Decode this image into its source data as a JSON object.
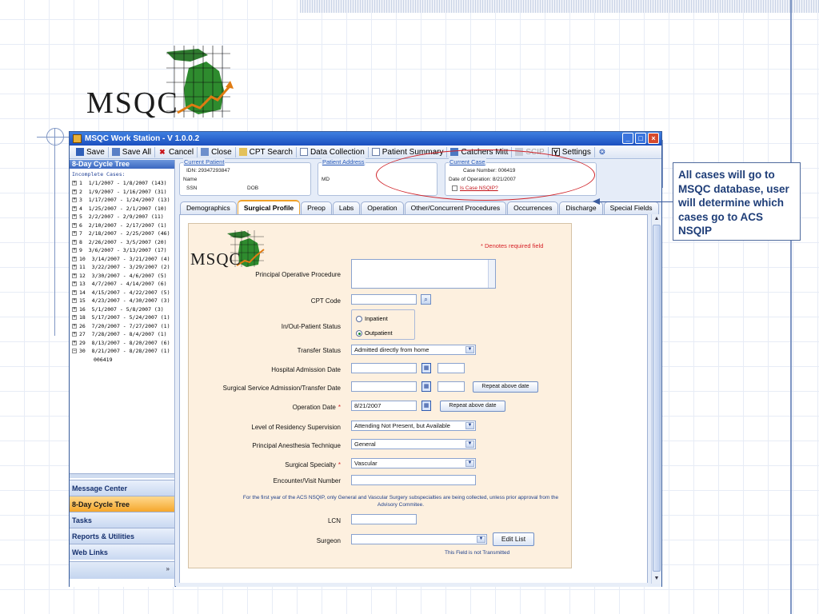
{
  "logo": {
    "text": "MSQC"
  },
  "window": {
    "title": "MSQC Work Station - V 1.0.0.2",
    "controls": [
      "_",
      "□",
      "×"
    ]
  },
  "toolbar": {
    "items": [
      {
        "label": "Save",
        "icon": "save-icon",
        "enabled": true
      },
      {
        "label": "Save All",
        "icon": "save-all-icon",
        "enabled": true
      },
      {
        "label": "Cancel",
        "icon": "cancel-icon",
        "enabled": true
      },
      {
        "label": "Close",
        "icon": "close-doc-icon",
        "enabled": true
      },
      {
        "label": "CPT Search",
        "icon": "cpt-search-icon",
        "enabled": true
      },
      {
        "label": "Data Collection",
        "icon": "document-icon",
        "enabled": true
      },
      {
        "label": "Patient Summary",
        "icon": "document-icon",
        "enabled": true
      },
      {
        "label": "Catchers Mitt",
        "icon": "chart-icon",
        "enabled": true
      },
      {
        "label": "SCIP",
        "icon": "scip-icon",
        "enabled": false
      },
      {
        "label": "Settings",
        "icon": "settings-icon",
        "enabled": true
      }
    ]
  },
  "sidebar": {
    "header": "8-Day Cycle Tree",
    "subheader": "Incomplete Cases:",
    "tree": [
      {
        "toggle": "+",
        "label": "1  1/1/2007 - 1/8/2007 (143)"
      },
      {
        "toggle": "+",
        "label": "2  1/9/2007 - 1/16/2007 (31)"
      },
      {
        "toggle": "+",
        "label": "3  1/17/2007 - 1/24/2007 (13)"
      },
      {
        "toggle": "+",
        "label": "4  1/25/2007 - 2/1/2007 (10)"
      },
      {
        "toggle": "+",
        "label": "5  2/2/2007 - 2/9/2007 (11)"
      },
      {
        "toggle": "+",
        "label": "6  2/10/2007 - 2/17/2007 (1)"
      },
      {
        "toggle": "+",
        "label": "7  2/18/2007 - 2/25/2007 (46)"
      },
      {
        "toggle": "+",
        "label": "8  2/26/2007 - 3/5/2007 (20)"
      },
      {
        "toggle": "+",
        "label": "9  3/6/2007 - 3/13/2007 (17)"
      },
      {
        "toggle": "+",
        "label": "10  3/14/2007 - 3/21/2007 (4)"
      },
      {
        "toggle": "+",
        "label": "11  3/22/2007 - 3/29/2007 (2)"
      },
      {
        "toggle": "+",
        "label": "12  3/30/2007 - 4/6/2007 (5)"
      },
      {
        "toggle": "+",
        "label": "13  4/7/2007 - 4/14/2007 (6)"
      },
      {
        "toggle": "+",
        "label": "14  4/15/2007 - 4/22/2007 (5)"
      },
      {
        "toggle": "+",
        "label": "15  4/23/2007 - 4/30/2007 (3)"
      },
      {
        "toggle": "+",
        "label": "16  5/1/2007 - 5/8/2007 (3)"
      },
      {
        "toggle": "+",
        "label": "18  5/17/2007 - 5/24/2007 (1)"
      },
      {
        "toggle": "+",
        "label": "26  7/20/2007 - 7/27/2007 (1)"
      },
      {
        "toggle": "+",
        "label": "27  7/28/2007 - 8/4/2007 (1)"
      },
      {
        "toggle": "+",
        "label": "29  8/13/2007 - 8/20/2007 (6)"
      },
      {
        "toggle": "−",
        "label": "30  8/21/2007 - 8/28/2007 (1)"
      }
    ],
    "leaf": "006419",
    "nav": [
      "Message Center",
      "8-Day Cycle Tree",
      "Tasks",
      "Reports & Utilities",
      "Web Links"
    ],
    "nav_more": "»"
  },
  "case_header": {
    "current_patient": {
      "title": "Current Patient",
      "idn": "IDN: 29347293847",
      "name": "Name",
      "ssn": "SSN",
      "dob": "DOB"
    },
    "patient_address": {
      "title": "Patient Address",
      "line": "MD"
    },
    "current_case": {
      "title": "Current Case",
      "case_number": "Case Number: 006419",
      "date": "Date of Operation: 8/21/2007",
      "link": "Is Case NSQIP?"
    }
  },
  "tabs": [
    "Demographics",
    "Surgical Profile",
    "Preop",
    "Labs",
    "Operation",
    "Other/Concurrent Procedures",
    "Occurrences",
    "Discharge",
    "Special Fields"
  ],
  "form": {
    "logo_text": "MSQC",
    "required_note": "* Denotes required field",
    "principal_procedure_label": "Principal Operative Procedure",
    "cpt_label": "CPT Code",
    "inout_label": "In/Out-Patient Status",
    "inpatient": "Inpatient",
    "outpatient": "Outpatient",
    "transfer_label": "Transfer Status",
    "transfer_value": "Admitted directly from home",
    "hospital_admission_label": "Hospital Admission Date",
    "surgical_service_label": "Surgical Service Admission/Transfer Date",
    "repeat_btn": "Repeat above date",
    "operation_date_label": "Operation Date",
    "operation_date_value": "8/21/2007",
    "residency_label": "Level of Residency Supervision",
    "residency_value": "Attending Not Present, but Available",
    "anesthesia_label": "Principal Anesthesia Technique",
    "anesthesia_value": "General",
    "specialty_label": "Surgical Specialty",
    "specialty_value": "Vascular",
    "encounter_label": "Encounter/Visit Number",
    "notice": "For the first year of the ACS NSQIP, only General and Vascular Surgery subspecialties are being collected, unless prior approval from the Advisory Commitee.",
    "lcn_label": "LCN",
    "surgeon_label": "Surgeon",
    "edit_list_btn": "Edit List",
    "not_transmitted": "This Field is not Transmitted",
    "required_star": "*"
  },
  "callout": {
    "text": "All cases will go to MSQC database, user will determine which cases go to ACS NSQIP"
  },
  "colors": {
    "accent": "#1b4fbf",
    "active_tab": "#f1a228",
    "required": "#d61f26",
    "form_bg": "#fdf0df"
  }
}
